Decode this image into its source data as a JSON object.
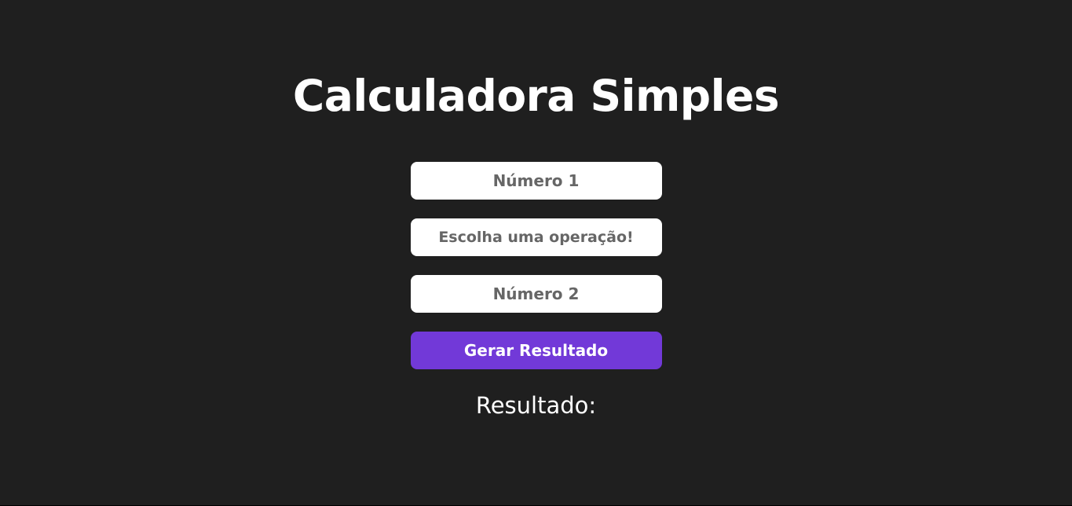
{
  "page": {
    "title": "Calculadora Simples"
  },
  "form": {
    "number1": {
      "value": "",
      "placeholder": "Número 1"
    },
    "operation": {
      "selected": "Escolha uma operação!"
    },
    "number2": {
      "value": "",
      "placeholder": "Número 2"
    },
    "submit_label": "Gerar Resultado"
  },
  "result": {
    "label": "Resultado:"
  },
  "colors": {
    "background": "#1f1f1f",
    "field_background": "#ffffff",
    "field_text": "#666666",
    "button_background": "#7239d8",
    "text": "#ffffff"
  }
}
